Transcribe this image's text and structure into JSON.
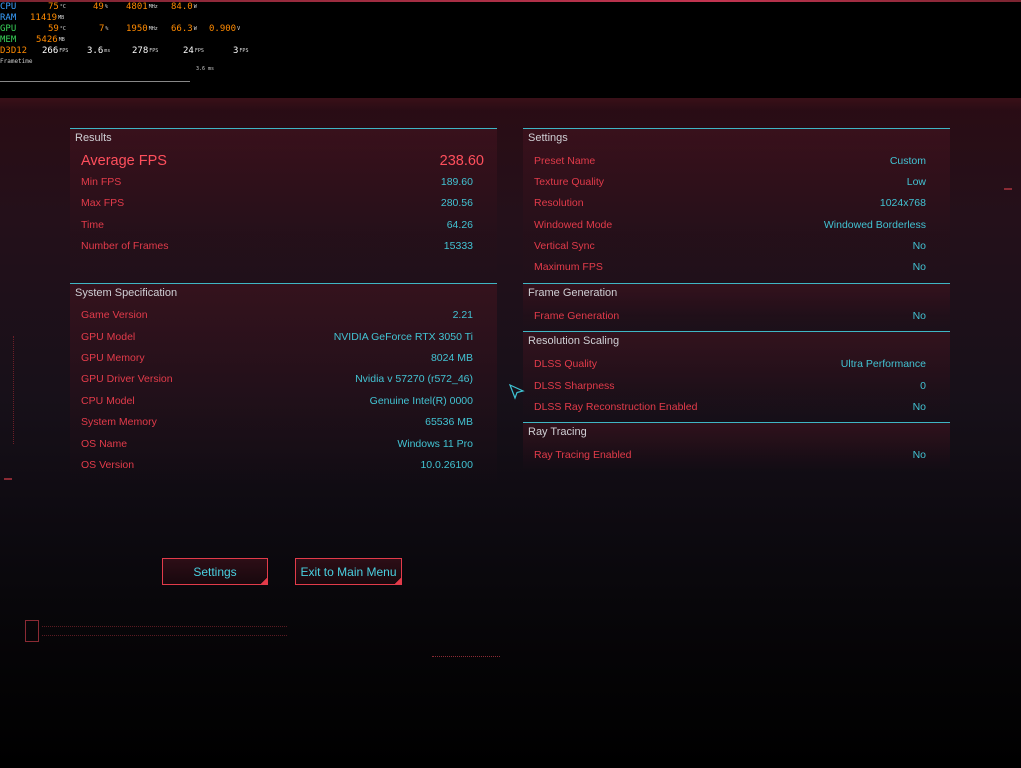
{
  "osd": {
    "cpu": {
      "label": "CPU",
      "temp": "75",
      "temp_unit": "°C",
      "load": "49",
      "load_unit": "%",
      "clock": "4801",
      "clock_unit": "MHz",
      "power": "84.0",
      "power_unit": "W"
    },
    "ram": {
      "label": "RAM",
      "used": "11419",
      "used_unit": "MB"
    },
    "gpu": {
      "label": "GPU",
      "temp": "59",
      "temp_unit": "°C",
      "load": "7",
      "load_unit": "%",
      "clock": "1950",
      "clock_unit": "MHz",
      "power": "66.3",
      "power_unit": "W",
      "volt": "0.900",
      "volt_unit": "V"
    },
    "mem": {
      "label": "MEM",
      "used": "5426",
      "used_unit": "MB"
    },
    "d3d": {
      "label": "D3D12",
      "fps": "266",
      "fps_unit": "FPS",
      "frametime": "3.6",
      "frametime_unit": "ms",
      "fps_avg": "278",
      "fps_avg_unit": "FPS",
      "fps_low": "24",
      "fps_low_unit": "FPS",
      "fps_min": "3",
      "fps_min_unit": "FPS"
    },
    "frametime_label": "Frametime",
    "frametime_ms": "3.6 ms"
  },
  "results": {
    "title": "Results",
    "average_fps": {
      "label": "Average FPS",
      "value": "238.60"
    },
    "rows": [
      {
        "label": "Min FPS",
        "value": "189.60"
      },
      {
        "label": "Max FPS",
        "value": "280.56"
      },
      {
        "label": "Time",
        "value": "64.26"
      },
      {
        "label": "Number of Frames",
        "value": "15333"
      }
    ]
  },
  "system": {
    "title": "System Specification",
    "rows": [
      {
        "label": "Game Version",
        "value": "2.21"
      },
      {
        "label": "GPU Model",
        "value": "NVIDIA GeForce RTX 3050 Ti"
      },
      {
        "label": "GPU Memory",
        "value": "8024 MB"
      },
      {
        "label": "GPU Driver Version",
        "value": "Nvidia v 57270 (r572_46)"
      },
      {
        "label": "CPU Model",
        "value": "Genuine Intel(R) 0000"
      },
      {
        "label": "System Memory",
        "value": "65536 MB"
      },
      {
        "label": "OS Name",
        "value": "Windows 11 Pro"
      },
      {
        "label": "OS Version",
        "value": "10.0.26100"
      }
    ]
  },
  "settings": {
    "title": "Settings",
    "rows": [
      {
        "label": "Preset Name",
        "value": "Custom"
      },
      {
        "label": "Texture Quality",
        "value": "Low"
      },
      {
        "label": "Resolution",
        "value": "1024x768"
      },
      {
        "label": "Windowed Mode",
        "value": "Windowed Borderless"
      },
      {
        "label": "Vertical Sync",
        "value": "No"
      },
      {
        "label": "Maximum FPS",
        "value": "No"
      }
    ]
  },
  "frame_generation": {
    "title": "Frame Generation",
    "rows": [
      {
        "label": "Frame Generation",
        "value": "No"
      }
    ]
  },
  "resolution_scaling": {
    "title": "Resolution Scaling",
    "rows": [
      {
        "label": "DLSS Quality",
        "value": "Ultra Performance"
      },
      {
        "label": "DLSS Sharpness",
        "value": "0"
      },
      {
        "label": "DLSS Ray Reconstruction Enabled",
        "value": "No"
      }
    ]
  },
  "ray_tracing": {
    "title": "Ray Tracing",
    "rows": [
      {
        "label": "Ray Tracing Enabled",
        "value": "No"
      }
    ]
  },
  "buttons": {
    "settings": "Settings",
    "exit": "Exit to Main Menu"
  },
  "colors": {
    "label_red": "#e23b4a",
    "value_cyan": "#42c3d3",
    "divider_cyan": "#3fb6c4",
    "highlight_red": "#ff4f5c",
    "osd_blue": "#3aa0ff",
    "osd_orange": "#ff8a00",
    "osd_green": "#39d35a"
  }
}
